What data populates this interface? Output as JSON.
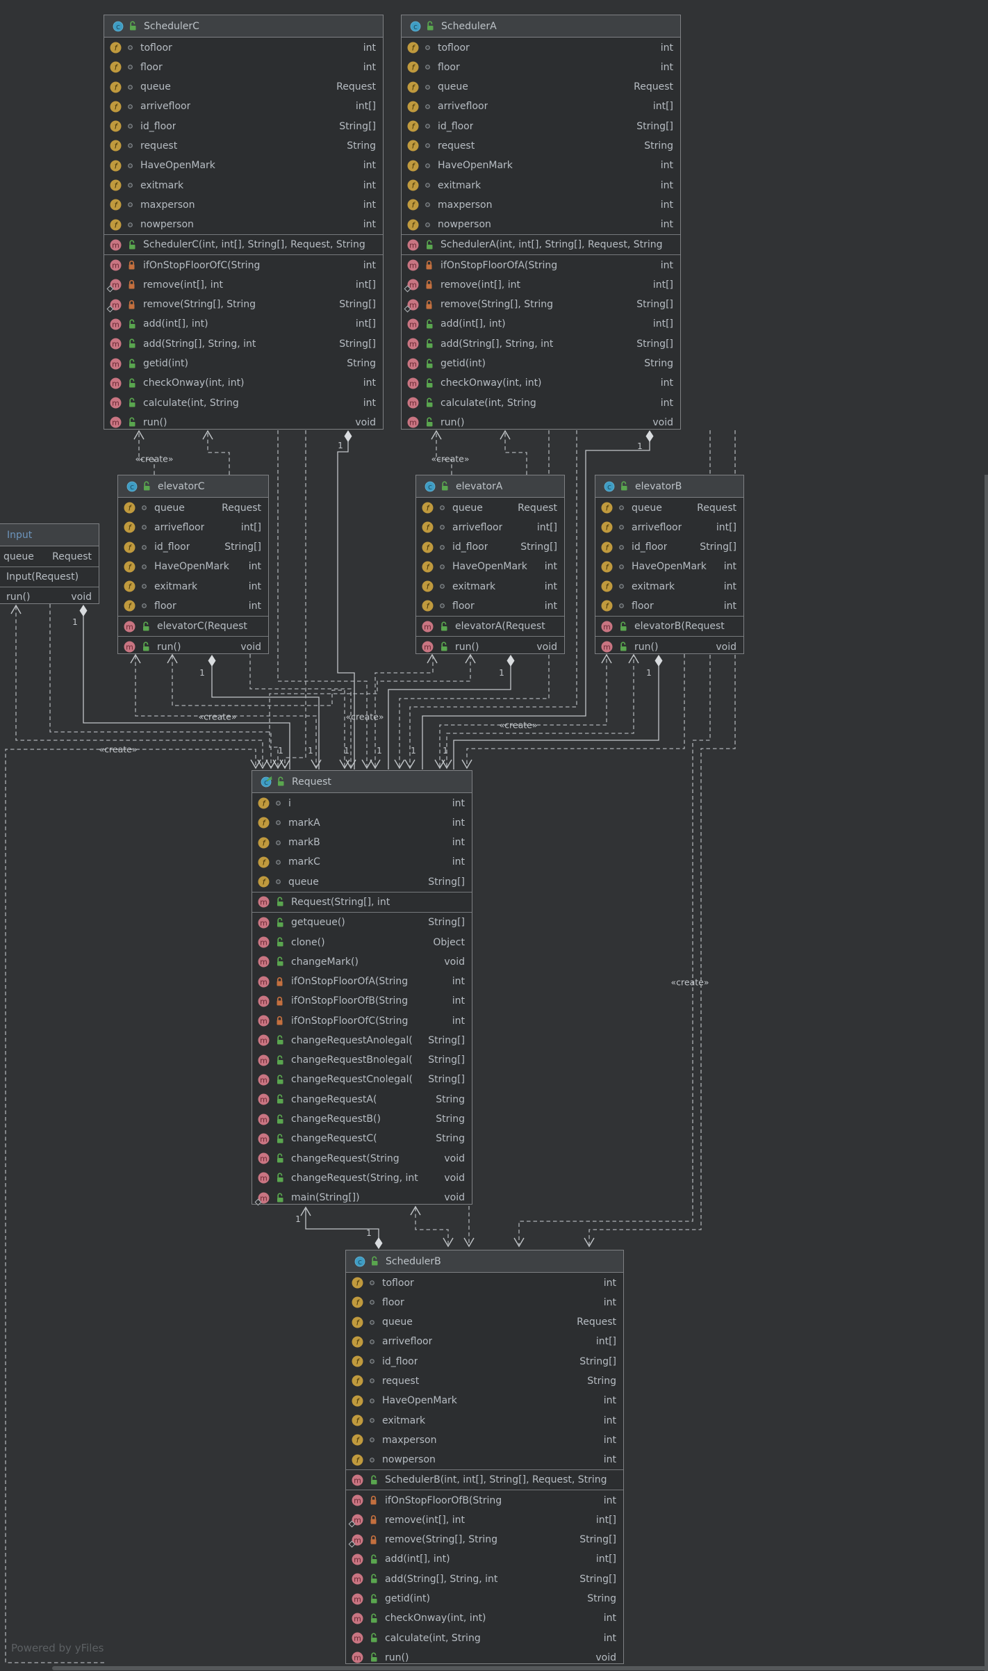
{
  "labels": {
    "create": "«create»",
    "one": "1"
  },
  "powered_by": "Powered by yFiles",
  "colors": {
    "canvas": "#313335",
    "box_body": "#2c2e30",
    "box_header": "#3e4144",
    "title_default": "#bdc3c8",
    "title_input": "#6d95bd",
    "field_icon": "#c09a3e",
    "method_icon": "#c97582",
    "class_icon": "#3f9dc4",
    "public_lock": "#5aa64f",
    "private_lock": "#c4703f"
  },
  "classes": [
    {
      "id": "SchedulerC",
      "title": "SchedulerC",
      "kind": "class",
      "fields": [
        {
          "name": "tofloor",
          "type": "int",
          "vis": "package"
        },
        {
          "name": "floor",
          "type": "int",
          "vis": "package"
        },
        {
          "name": "queue",
          "type": "Request",
          "vis": "package"
        },
        {
          "name": "arrivefloor",
          "type": "int[]",
          "vis": "package"
        },
        {
          "name": "id_floor",
          "type": "String[]",
          "vis": "package"
        },
        {
          "name": "request",
          "type": "String",
          "vis": "package"
        },
        {
          "name": "HaveOpenMark",
          "type": "int",
          "vis": "package"
        },
        {
          "name": "exitmark",
          "type": "int",
          "vis": "package"
        },
        {
          "name": "maxperson",
          "type": "int",
          "vis": "package"
        },
        {
          "name": "nowperson",
          "type": "int",
          "vis": "package"
        }
      ],
      "ctors": [
        {
          "name": "SchedulerC(int, int[], String[], Request, String",
          "type": "",
          "vis": "public"
        }
      ],
      "methods": [
        {
          "name": "ifOnStopFloorOfC(String",
          "type": "int",
          "vis": "private"
        },
        {
          "name": "remove(int[], int",
          "type": "int[]",
          "vis": "private",
          "static": true
        },
        {
          "name": "remove(String[], String",
          "type": "String[]",
          "vis": "private",
          "static": true
        },
        {
          "name": "add(int[], int)",
          "type": "int[]",
          "vis": "public"
        },
        {
          "name": "add(String[], String, int",
          "type": "String[]",
          "vis": "public"
        },
        {
          "name": "getid(int)",
          "type": "String",
          "vis": "public"
        },
        {
          "name": "checkOnway(int, int)",
          "type": "int",
          "vis": "public"
        },
        {
          "name": "calculate(int, String",
          "type": "int",
          "vis": "public"
        },
        {
          "name": "run()",
          "type": "void",
          "vis": "public"
        }
      ]
    },
    {
      "id": "SchedulerA",
      "title": "SchedulerA",
      "kind": "class",
      "fields": [
        {
          "name": "tofloor",
          "type": "int",
          "vis": "package"
        },
        {
          "name": "floor",
          "type": "int",
          "vis": "package"
        },
        {
          "name": "queue",
          "type": "Request",
          "vis": "package"
        },
        {
          "name": "arrivefloor",
          "type": "int[]",
          "vis": "package"
        },
        {
          "name": "id_floor",
          "type": "String[]",
          "vis": "package"
        },
        {
          "name": "request",
          "type": "String",
          "vis": "package"
        },
        {
          "name": "HaveOpenMark",
          "type": "int",
          "vis": "package"
        },
        {
          "name": "exitmark",
          "type": "int",
          "vis": "package"
        },
        {
          "name": "maxperson",
          "type": "int",
          "vis": "package"
        },
        {
          "name": "nowperson",
          "type": "int",
          "vis": "package"
        }
      ],
      "ctors": [
        {
          "name": "SchedulerA(int, int[], String[], Request, String",
          "type": "",
          "vis": "public"
        }
      ],
      "methods": [
        {
          "name": "ifOnStopFloorOfA(String",
          "type": "int",
          "vis": "private"
        },
        {
          "name": "remove(int[], int",
          "type": "int[]",
          "vis": "private",
          "static": true
        },
        {
          "name": "remove(String[], String",
          "type": "String[]",
          "vis": "private",
          "static": true
        },
        {
          "name": "add(int[], int)",
          "type": "int[]",
          "vis": "public"
        },
        {
          "name": "add(String[], String, int",
          "type": "String[]",
          "vis": "public"
        },
        {
          "name": "getid(int)",
          "type": "String",
          "vis": "public"
        },
        {
          "name": "checkOnway(int, int)",
          "type": "int",
          "vis": "public"
        },
        {
          "name": "calculate(int, String",
          "type": "int",
          "vis": "public"
        },
        {
          "name": "run()",
          "type": "void",
          "vis": "public"
        }
      ]
    },
    {
      "id": "elevatorC",
      "title": "elevatorC",
      "kind": "class",
      "fields": [
        {
          "name": "queue",
          "type": "Request",
          "vis": "package"
        },
        {
          "name": "arrivefloor",
          "type": "int[]",
          "vis": "package"
        },
        {
          "name": "id_floor",
          "type": "String[]",
          "vis": "package"
        },
        {
          "name": "HaveOpenMark",
          "type": "int",
          "vis": "package"
        },
        {
          "name": "exitmark",
          "type": "int",
          "vis": "package"
        },
        {
          "name": "floor",
          "type": "int",
          "vis": "package"
        }
      ],
      "ctors": [
        {
          "name": "elevatorC(Request",
          "type": "",
          "vis": "public"
        }
      ],
      "methods": [
        {
          "name": "run()",
          "type": "void",
          "vis": "public"
        }
      ]
    },
    {
      "id": "elevatorA",
      "title": "elevatorA",
      "kind": "class",
      "fields": [
        {
          "name": "queue",
          "type": "Request",
          "vis": "package"
        },
        {
          "name": "arrivefloor",
          "type": "int[]",
          "vis": "package"
        },
        {
          "name": "id_floor",
          "type": "String[]",
          "vis": "package"
        },
        {
          "name": "HaveOpenMark",
          "type": "int",
          "vis": "package"
        },
        {
          "name": "exitmark",
          "type": "int",
          "vis": "package"
        },
        {
          "name": "floor",
          "type": "int",
          "vis": "package"
        }
      ],
      "ctors": [
        {
          "name": "elevatorA(Request",
          "type": "",
          "vis": "public"
        }
      ],
      "methods": [
        {
          "name": "run()",
          "type": "void",
          "vis": "public"
        }
      ]
    },
    {
      "id": "elevatorB",
      "title": "elevatorB",
      "kind": "class",
      "fields": [
        {
          "name": "queue",
          "type": "Request",
          "vis": "package"
        },
        {
          "name": "arrivefloor",
          "type": "int[]",
          "vis": "package"
        },
        {
          "name": "id_floor",
          "type": "String[]",
          "vis": "package"
        },
        {
          "name": "HaveOpenMark",
          "type": "int",
          "vis": "package"
        },
        {
          "name": "exitmark",
          "type": "int",
          "vis": "package"
        },
        {
          "name": "floor",
          "type": "int",
          "vis": "package"
        }
      ],
      "ctors": [
        {
          "name": "elevatorB(Request",
          "type": "",
          "vis": "public"
        }
      ],
      "methods": [
        {
          "name": "run()",
          "type": "void",
          "vis": "public"
        }
      ]
    },
    {
      "id": "Input",
      "title": "Input",
      "kind": "class",
      "fields": [
        {
          "name": "queue",
          "type": "Request",
          "vis": "package"
        }
      ],
      "ctors": [
        {
          "name": "Input(Request)",
          "type": "",
          "vis": "public"
        }
      ],
      "methods": [
        {
          "name": "run()",
          "type": "void",
          "vis": "public"
        }
      ]
    },
    {
      "id": "Request",
      "title": "Request",
      "kind": "class-arrow",
      "fields": [
        {
          "name": "i",
          "type": "int",
          "vis": "package"
        },
        {
          "name": "markA",
          "type": "int",
          "vis": "package"
        },
        {
          "name": "markB",
          "type": "int",
          "vis": "package"
        },
        {
          "name": "markC",
          "type": "int",
          "vis": "package"
        },
        {
          "name": "queue",
          "type": "String[]",
          "vis": "package"
        }
      ],
      "ctors": [
        {
          "name": "Request(String[], int",
          "type": "",
          "vis": "public"
        }
      ],
      "methods": [
        {
          "name": "getqueue()",
          "type": "String[]",
          "vis": "public"
        },
        {
          "name": "clone()",
          "type": "Object",
          "vis": "public"
        },
        {
          "name": "changeMark()",
          "type": "void",
          "vis": "public"
        },
        {
          "name": "ifOnStopFloorOfA(String",
          "type": "int",
          "vis": "private"
        },
        {
          "name": "ifOnStopFloorOfB(String",
          "type": "int",
          "vis": "private"
        },
        {
          "name": "ifOnStopFloorOfC(String",
          "type": "int",
          "vis": "private"
        },
        {
          "name": "changeRequestAnolegal(",
          "type": "String[]",
          "vis": "public"
        },
        {
          "name": "changeRequestBnolegal(",
          "type": "String[]",
          "vis": "public"
        },
        {
          "name": "changeRequestCnolegal(",
          "type": "String[]",
          "vis": "public"
        },
        {
          "name": "changeRequestA(",
          "type": "String",
          "vis": "public"
        },
        {
          "name": "changeRequestB()",
          "type": "String",
          "vis": "public"
        },
        {
          "name": "changeRequestC(",
          "type": "String",
          "vis": "public"
        },
        {
          "name": "changeRequest(String",
          "type": "void",
          "vis": "public"
        },
        {
          "name": "changeRequest(String, int",
          "type": "void",
          "vis": "public"
        },
        {
          "name": "main(String[])",
          "type": "void",
          "vis": "public",
          "static": true
        }
      ]
    },
    {
      "id": "SchedulerB",
      "title": "SchedulerB",
      "kind": "class",
      "fields": [
        {
          "name": "tofloor",
          "type": "int",
          "vis": "package"
        },
        {
          "name": "floor",
          "type": "int",
          "vis": "package"
        },
        {
          "name": "queue",
          "type": "Request",
          "vis": "package"
        },
        {
          "name": "arrivefloor",
          "type": "int[]",
          "vis": "package"
        },
        {
          "name": "id_floor",
          "type": "String[]",
          "vis": "package"
        },
        {
          "name": "request",
          "type": "String",
          "vis": "package"
        },
        {
          "name": "HaveOpenMark",
          "type": "int",
          "vis": "package"
        },
        {
          "name": "exitmark",
          "type": "int",
          "vis": "package"
        },
        {
          "name": "maxperson",
          "type": "int",
          "vis": "package"
        },
        {
          "name": "nowperson",
          "type": "int",
          "vis": "package"
        }
      ],
      "ctors": [
        {
          "name": "SchedulerB(int, int[], String[], Request, String",
          "type": "",
          "vis": "public"
        }
      ],
      "methods": [
        {
          "name": "ifOnStopFloorOfB(String",
          "type": "int",
          "vis": "private"
        },
        {
          "name": "remove(int[], int",
          "type": "int[]",
          "vis": "private",
          "static": true
        },
        {
          "name": "remove(String[], String",
          "type": "String[]",
          "vis": "private",
          "static": true
        },
        {
          "name": "add(int[], int)",
          "type": "int[]",
          "vis": "public"
        },
        {
          "name": "add(String[], String, int",
          "type": "String[]",
          "vis": "public"
        },
        {
          "name": "getid(int)",
          "type": "String",
          "vis": "public"
        },
        {
          "name": "checkOnway(int, int)",
          "type": "int",
          "vis": "public"
        },
        {
          "name": "calculate(int, String",
          "type": "int",
          "vis": "public"
        },
        {
          "name": "run()",
          "type": "void",
          "vis": "public"
        }
      ]
    }
  ]
}
